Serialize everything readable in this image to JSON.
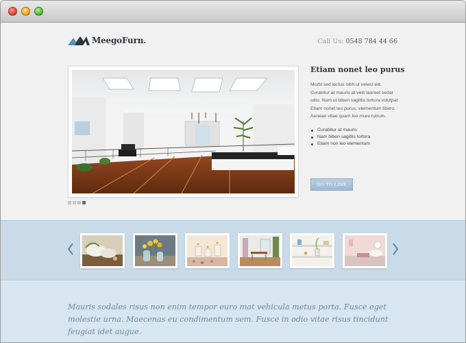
{
  "window": {
    "controls": [
      "close",
      "minimize",
      "zoom"
    ],
    "colors": {
      "close": "#e0443a",
      "minimize": "#e6a820",
      "zoom": "#53b638"
    }
  },
  "header": {
    "logo_text": "MeegoFurn.",
    "call_label": "Call Us:",
    "phone": "0548 784 44 66"
  },
  "slider": {
    "dots": 4,
    "active_dot": 4
  },
  "sidebar": {
    "title": "Etiam nonet leo purus",
    "text": "Morbi sed lectus nibh ut velest elit. Curabitur at mauris at velit laoreet sedat odio. Nam ut biben sagittis tortora volutpat. Etiam nonet leo purus, elementum libero. Aenean vitae quam leo mure rutrum.",
    "list": [
      "Curabitur at mauris",
      "Nam biben sagittis tortora",
      "Etiam non leo elementum"
    ],
    "button_label": "GO TO LINK"
  },
  "gallery": {
    "thumbs": [
      "spa-towels-photo",
      "flowers-bottles-photo",
      "candles-photo",
      "dining-room-photo",
      "shelf-vase-photo",
      "pink-room-photo"
    ]
  },
  "quote": {
    "text": "Mauris sodales risus non enim tempor euro mat vehicula metus porta. Fusce eget molestie urna. Maecenas eu condimentum sem. Fusce in odio vitae risus tincidunt feugiat idet augue."
  },
  "colors": {
    "accent": "#9fbad1",
    "strip_bg": "#c9dbe8",
    "bottom_bg": "#d7e6f0",
    "quote_text": "#6d8aa3"
  }
}
